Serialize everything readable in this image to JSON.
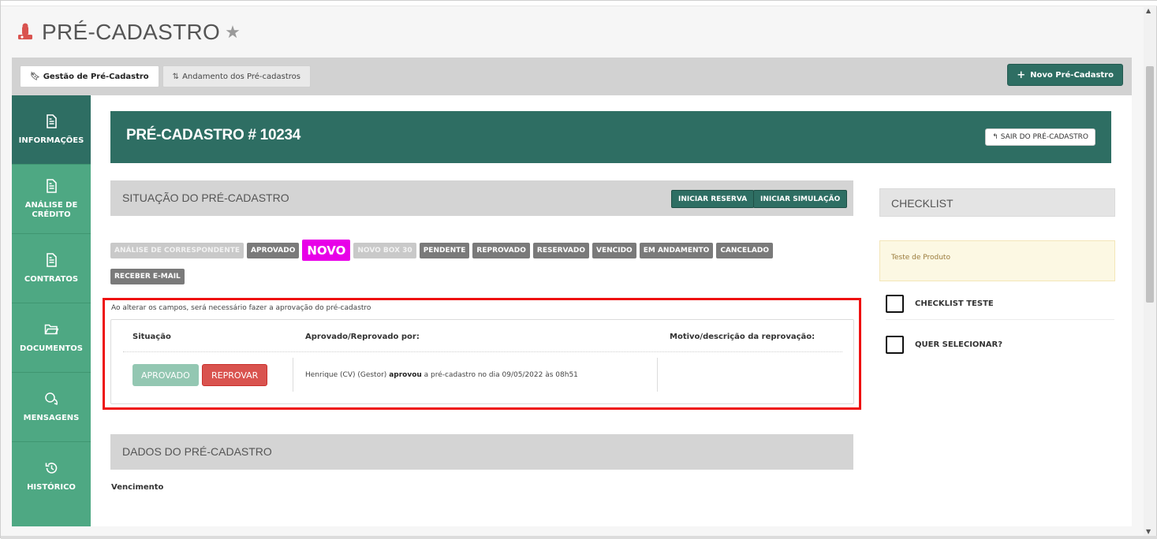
{
  "page": {
    "title": "PRÉ-CADASTRO"
  },
  "toolbar": {
    "tabs": [
      {
        "label": "Gestão de Pré-Cadastro"
      },
      {
        "label": "Andamento dos Pré-cadastros"
      }
    ],
    "new_button": "Novo Pré-Cadastro"
  },
  "sidebar": {
    "items": [
      {
        "label": "INFORMAÇÕES"
      },
      {
        "label": "ANÁLISE DE CRÉDITO"
      },
      {
        "label": "CONTRATOS"
      },
      {
        "label": "DOCUMENTOS"
      },
      {
        "label": "MENSAGENS"
      },
      {
        "label": "HISTÓRICO"
      }
    ]
  },
  "banner": {
    "title": "PRÉ-CADASTRO # 10234",
    "exit_button": "SAIR DO PRÉ-CADASTRO"
  },
  "situacao": {
    "title": "SITUAÇÃO DO PRÉ-CADASTRO",
    "buttons": {
      "reserva": "INICIAR RESERVA",
      "simulacao": "INICIAR SIMULAÇÃO"
    },
    "statuses": [
      "ANÁLISE DE CORRESPONDENTE",
      "APROVADO",
      "NOVO",
      "NOVO BOX 30",
      "PENDENTE",
      "REPROVADO",
      "RESERVADO",
      "VENCIDO",
      "EM ANDAMENTO",
      "CANCELADO",
      "RECEBER E-MAIL"
    ]
  },
  "approval": {
    "note": "Ao alterar os campos, será necessário fazer a aprovação do pré-cadastro",
    "headers": {
      "situacao": "Situação",
      "por": "Aprovado/Reprovado por:",
      "motivo": "Motivo/descrição da reprovação:"
    },
    "approved_button": "APROVADO",
    "reject_button": "REPROVAR",
    "by_name": "Henrique (CV) (Gestor)",
    "action": "aprovou",
    "detail": "a pré-cadastro no dia 09/05/2022 às 08h51"
  },
  "dados": {
    "title": "DADOS DO PRÉ-CADASTRO",
    "vencimento_label": "Vencimento"
  },
  "checklist": {
    "title": "CHECKLIST",
    "product": "Teste de Produto",
    "items": [
      {
        "label": "CHECKLIST TESTE"
      },
      {
        "label": "QUER SELECIONAR?"
      }
    ]
  },
  "colors": {
    "primary": "#2e6e63",
    "sidebar": "#4ea883",
    "novo": "#e800e8",
    "danger": "#d9534f",
    "highlight": "#ee1111"
  }
}
